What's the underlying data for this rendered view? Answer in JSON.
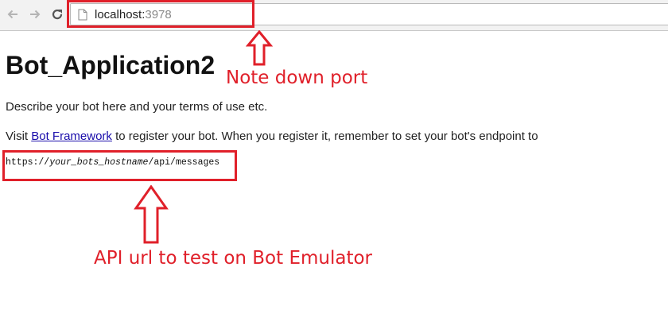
{
  "browser": {
    "url_host": "localhost:",
    "url_port": "3978",
    "icons": {
      "back": "arrow-left-icon",
      "forward": "arrow-right-icon",
      "reload": "reload-icon",
      "page": "page-icon"
    }
  },
  "page": {
    "title": "Bot_Application2",
    "description": "Describe your bot here and your terms of use etc.",
    "register_prefix": "Visit ",
    "register_link": "Bot Framework",
    "register_suffix": " to register your bot. When you register it, remember to set your bot's endpoint to",
    "endpoint_prefix": "https://",
    "endpoint_host": "your_bots_hostname",
    "endpoint_path": "/api/messages"
  },
  "annotations": {
    "port_note": "Note down port",
    "api_note": "API url to test on Bot Emulator",
    "color": "#e0202a"
  }
}
